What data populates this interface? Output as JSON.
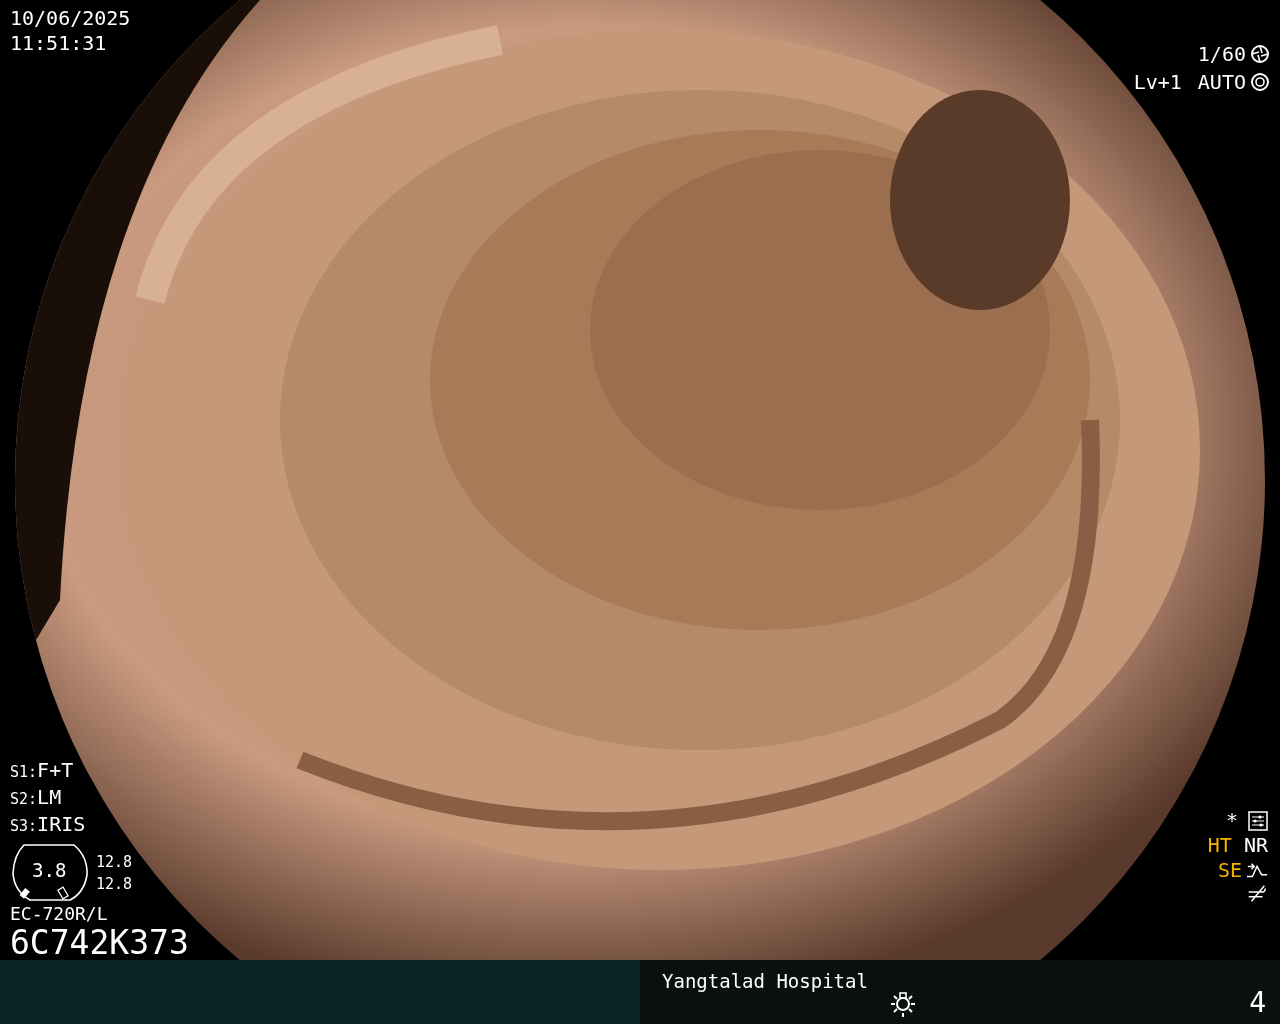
{
  "datetime": {
    "date": "10/06/2025",
    "time": "11:51:31"
  },
  "exposure": {
    "shutter": "1/60",
    "level": "Lv+1",
    "iris_mode": "AUTO"
  },
  "switches": [
    {
      "key": "S1:",
      "value": "F+T"
    },
    {
      "key": "S2:",
      "value": "LM"
    },
    {
      "key": "S3:",
      "value": "IRIS"
    }
  ],
  "scope": {
    "gauge_value": "3.8",
    "readings": [
      "12.8",
      "12.8"
    ],
    "model": "EC-720R/L",
    "serial": "6C742K373"
  },
  "settings_mark": "*",
  "enhancements": [
    {
      "label": "HT",
      "active": true
    },
    {
      "label": "NR",
      "active": false
    },
    {
      "label": "SE",
      "active": true
    }
  ],
  "footer": {
    "hospital": "Yangtalad Hospital",
    "page": "4"
  }
}
